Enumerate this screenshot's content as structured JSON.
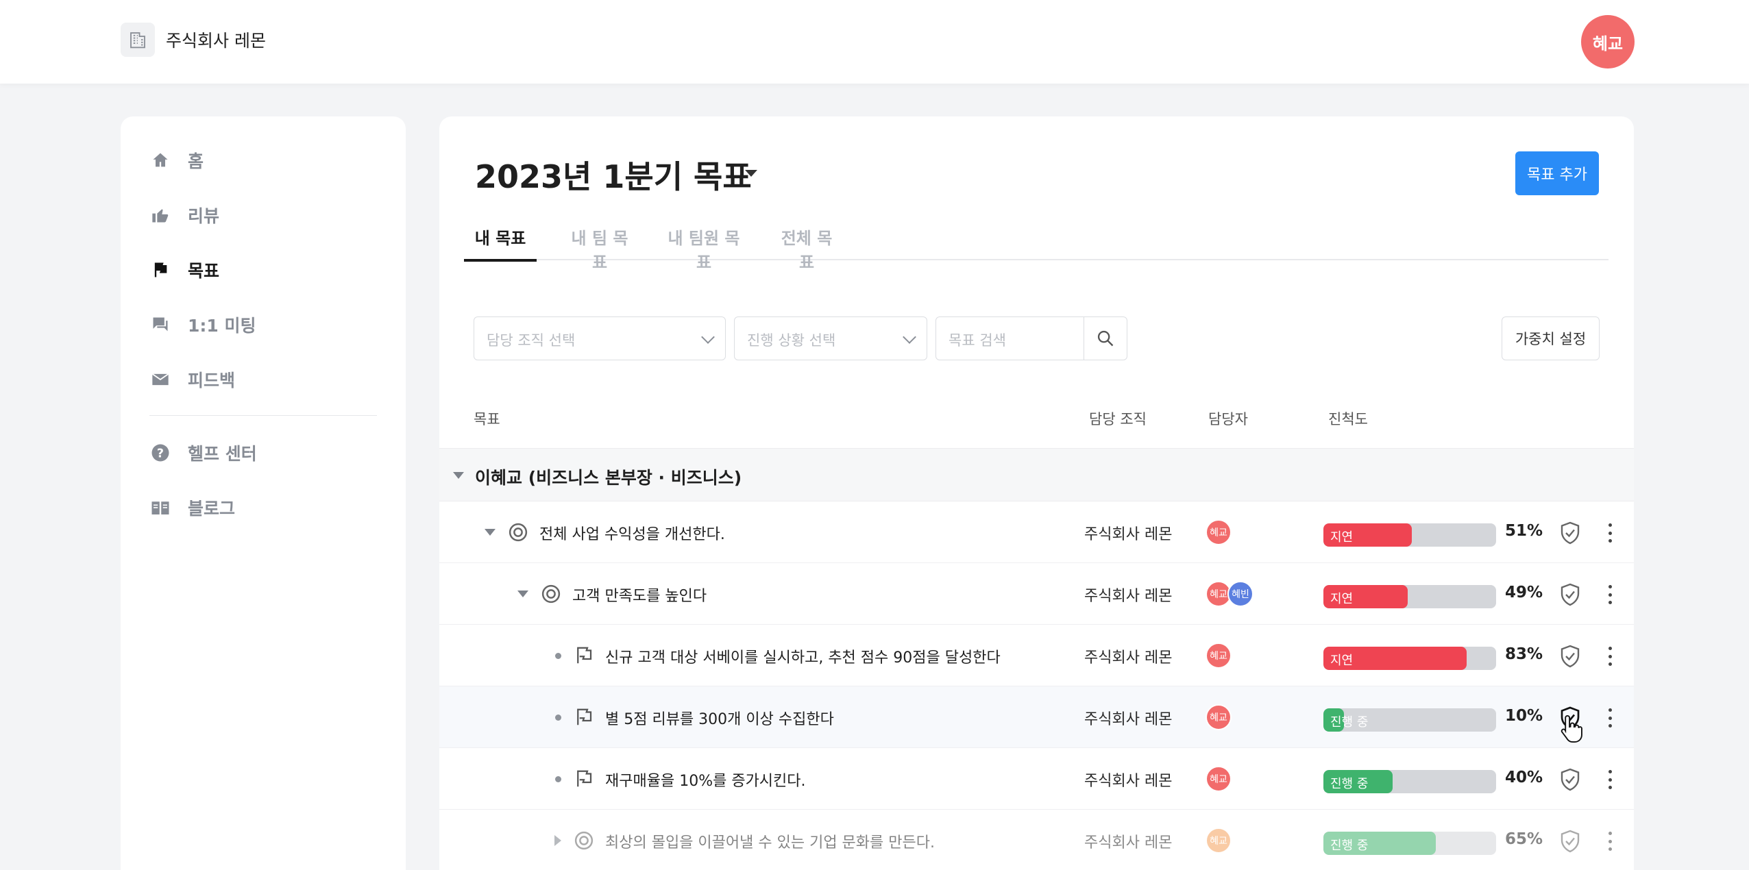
{
  "header": {
    "company_name": "주식회사 레몬",
    "user_avatar": "혜교"
  },
  "sidebar": {
    "items": [
      {
        "label": "홈",
        "icon": "home-icon"
      },
      {
        "label": "리뷰",
        "icon": "thumbs-up-icon"
      },
      {
        "label": "목표",
        "icon": "flag-icon",
        "active": true
      },
      {
        "label": "1:1 미팅",
        "icon": "chat-icon"
      },
      {
        "label": "피드백",
        "icon": "mail-icon"
      },
      {
        "label": "헬프 센터",
        "icon": "help-icon"
      },
      {
        "label": "블로그",
        "icon": "book-icon"
      }
    ]
  },
  "main": {
    "title": "2023년 1분기 목표",
    "add_button": "목표 추가",
    "tabs": [
      {
        "label": "내 목표",
        "active": true
      },
      {
        "label": "내 팀 목표"
      },
      {
        "label": "내 팀원 목표"
      },
      {
        "label": "전체 목표"
      }
    ],
    "filters": {
      "org_placeholder": "담당 조직 선택",
      "status_placeholder": "진행 상황 선택",
      "search_placeholder": "목표 검색",
      "weight_button": "가중치 설정"
    },
    "columns": {
      "goal": "목표",
      "org": "담당 조직",
      "owner": "담당자",
      "progress": "진척도"
    },
    "group": "이혜교 (비즈니스 본부장 · 비즈니스)",
    "rows": [
      {
        "name": "전체 사업 수익성을 개선한다.",
        "org": "주식회사 레몬",
        "owners": [
          "혜교"
        ],
        "status": "지연",
        "progress": 51,
        "pct": "51%"
      },
      {
        "name": "고객 만족도를 높인다",
        "org": "주식회사 레몬",
        "owners": [
          "혜교",
          "혜빈"
        ],
        "status": "지연",
        "progress": 49,
        "pct": "49%"
      },
      {
        "name": "신규 고객 대상 서베이를 실시하고, 추천 점수 90점을 달성한다",
        "org": "주식회사 레몬",
        "owners": [
          "혜교"
        ],
        "status": "지연",
        "progress": 83,
        "pct": "83%"
      },
      {
        "name": "별 5점 리뷰를 300개 이상 수집한다",
        "org": "주식회사 레몬",
        "owners": [
          "혜교"
        ],
        "status": "진행 중",
        "progress": 10,
        "pct": "10%"
      },
      {
        "name": "재구매율을 10%를 증가시킨다.",
        "org": "주식회사 레몬",
        "owners": [
          "혜교"
        ],
        "status": "진행 중",
        "progress": 40,
        "pct": "40%"
      },
      {
        "name": "최상의 몰입을 이끌어낼 수 있는 기업 문화를 만든다.",
        "org": "주식회사 레몬",
        "owners": [
          "혜교"
        ],
        "status": "진행 중",
        "progress": 65,
        "pct": "65%"
      }
    ]
  },
  "colors": {
    "accent": "#2a8cf7",
    "delayed": "#ef4452",
    "in_progress": "#3fb36d",
    "avatar_primary": "#f26b6b",
    "avatar_secondary": "#5b7fe0"
  }
}
